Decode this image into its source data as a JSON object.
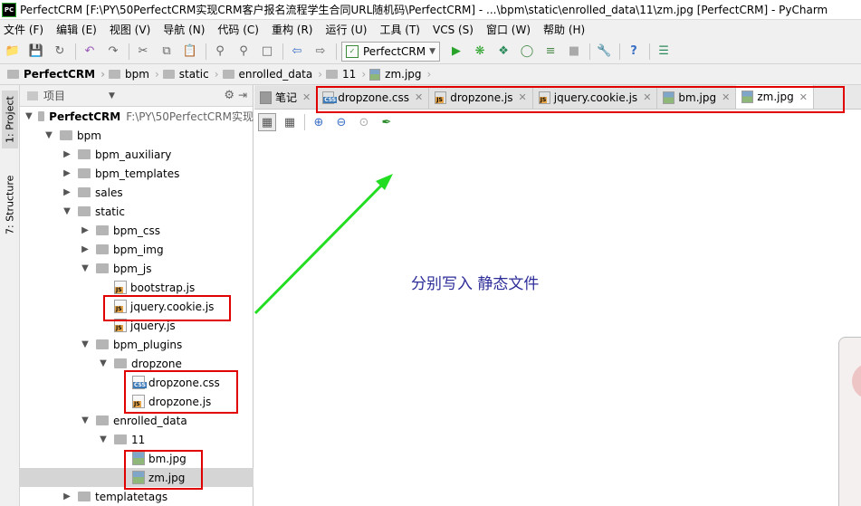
{
  "window": {
    "app_icon_text": "PC",
    "title": "PerfectCRM [F:\\PY\\50PerfectCRM实现CRM客户报名流程学生合同URL随机码\\PerfectCRM] - ...\\bpm\\static\\enrolled_data\\11\\zm.jpg [PerfectCRM] - PyCharm"
  },
  "menubar": {
    "items": [
      "文件 (F)",
      "编辑 (E)",
      "视图 (V)",
      "导航 (N)",
      "代码 (C)",
      "重构 (R)",
      "运行 (U)",
      "工具 (T)",
      "VCS (S)",
      "窗口 (W)",
      "帮助 (H)"
    ]
  },
  "toolbar": {
    "run_config": "PerfectCRM"
  },
  "breadcrumb": [
    "PerfectCRM",
    "bpm",
    "static",
    "enrolled_data",
    "11",
    "zm.jpg"
  ],
  "left_strip": {
    "project_tab": "1: Project",
    "structure_tab": "7: Structure"
  },
  "project_panel": {
    "header_label": "项目",
    "root_name": "PerfectCRM",
    "root_path": "F:\\PY\\50PerfectCRM实现",
    "tree": [
      {
        "label": "bpm",
        "type": "folder",
        "depth": 1,
        "expanded": true
      },
      {
        "label": "bpm_auxiliary",
        "type": "folder",
        "depth": 2,
        "expanded": false
      },
      {
        "label": "bpm_templates",
        "type": "folder",
        "depth": 2,
        "expanded": false
      },
      {
        "label": "sales",
        "type": "folder",
        "depth": 2,
        "expanded": false
      },
      {
        "label": "static",
        "type": "folder",
        "depth": 2,
        "expanded": true
      },
      {
        "label": "bpm_css",
        "type": "folder",
        "depth": 3,
        "expanded": false
      },
      {
        "label": "bpm_img",
        "type": "folder",
        "depth": 3,
        "expanded": false
      },
      {
        "label": "bpm_js",
        "type": "folder",
        "depth": 3,
        "expanded": true
      },
      {
        "label": "bootstrap.js",
        "type": "js",
        "depth": 4
      },
      {
        "label": "jquery.cookie.js",
        "type": "js",
        "depth": 4
      },
      {
        "label": "jquery.js",
        "type": "js",
        "depth": 4
      },
      {
        "label": "bpm_plugins",
        "type": "folder",
        "depth": 3,
        "expanded": true
      },
      {
        "label": "dropzone",
        "type": "folder",
        "depth": 4,
        "expanded": true
      },
      {
        "label": "dropzone.css",
        "type": "css",
        "depth": 5
      },
      {
        "label": "dropzone.js",
        "type": "js",
        "depth": 5
      },
      {
        "label": "enrolled_data",
        "type": "folder",
        "depth": 3,
        "expanded": true
      },
      {
        "label": "11",
        "type": "folder",
        "depth": 4,
        "expanded": true
      },
      {
        "label": "bm.jpg",
        "type": "jpg",
        "depth": 5
      },
      {
        "label": "zm.jpg",
        "type": "jpg",
        "depth": 5,
        "selected": true
      },
      {
        "label": "templatetags",
        "type": "folder",
        "depth": 2,
        "expanded": false
      }
    ]
  },
  "editor_tabs": [
    {
      "label": "笔记",
      "type": "note"
    },
    {
      "label": "dropzone.css",
      "type": "css"
    },
    {
      "label": "dropzone.js",
      "type": "js"
    },
    {
      "label": "jquery.cookie.js",
      "type": "js"
    },
    {
      "label": "bm.jpg",
      "type": "jpg"
    },
    {
      "label": "zm.jpg",
      "type": "jpg",
      "active": true
    }
  ],
  "annotation": {
    "text": "分别写入  静态文件",
    "highlight_color": "#e00000",
    "arrow_color": "#22dd22"
  }
}
